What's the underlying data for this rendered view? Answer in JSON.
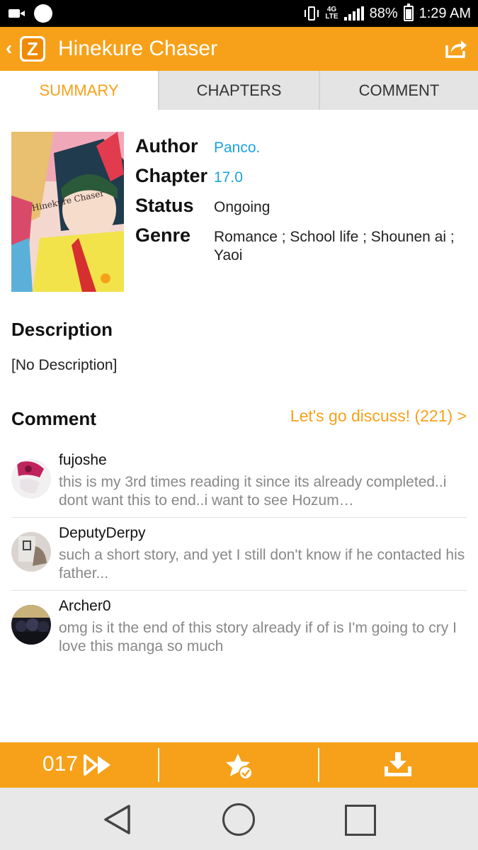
{
  "status_bar": {
    "battery": "88%",
    "time": "1:29 AM",
    "network_label": "4G LTE"
  },
  "app_bar": {
    "logo_letter": "Z",
    "title": "Hinekure Chaser"
  },
  "tabs": [
    {
      "label": "SUMMARY",
      "active": true
    },
    {
      "label": "CHAPTERS",
      "active": false
    },
    {
      "label": "COMMENT",
      "active": false
    }
  ],
  "info": {
    "author_label": "Author",
    "author": "Panco.",
    "chapter_label": "Chapter",
    "chapter": "17.0",
    "status_label": "Status",
    "status": "Ongoing",
    "genre_label": "Genre",
    "genre": "Romance ; School life ; Shounen ai ; Yaoi",
    "cover_text": "Hinekure Chaser"
  },
  "description": {
    "title": "Description",
    "text": "[No Description]"
  },
  "comments": {
    "title": "Comment",
    "discuss_link": "Let's go discuss! (221) >",
    "items": [
      {
        "user": "fujoshe",
        "text": "this is my 3rd times reading it since its already completed..i dont want this to end..i want to see Hozum…"
      },
      {
        "user": "DeputyDerpy",
        "text": "such a short story, and yet I still don't know if he contacted his father..."
      },
      {
        "user": "Archer0",
        "text": "omg is it the end of this story already if of is I'm going to cry I love this manga so much"
      }
    ]
  },
  "action_bar": {
    "chapter_number": "017"
  },
  "colors": {
    "accent": "#f7a11a",
    "link": "#1aa3e0"
  }
}
